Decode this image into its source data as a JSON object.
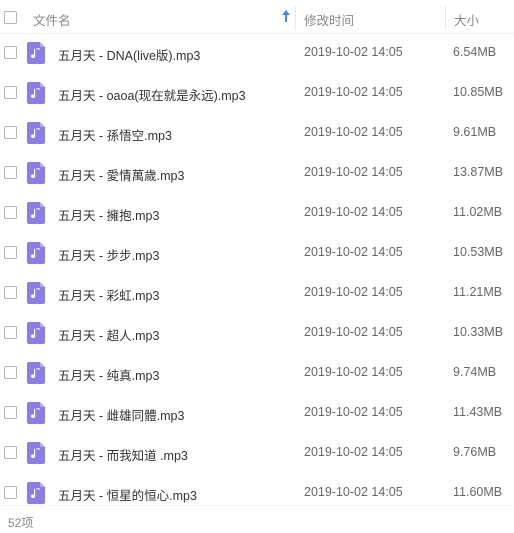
{
  "header": {
    "name_label": "文件名",
    "time_label": "修改时间",
    "size_label": "大小",
    "sort_direction": "ascending",
    "sort_color": "#3b8cff"
  },
  "icon_color": "#8a7ee6",
  "files": [
    {
      "name": "五月天 - DNA(live版).mp3",
      "time": "2019-10-02 14:05",
      "size": "6.54MB"
    },
    {
      "name": "五月天 - oaoa(现在就是永远).mp3",
      "time": "2019-10-02 14:05",
      "size": "10.85MB"
    },
    {
      "name": "五月天 - 孫悟空.mp3",
      "time": "2019-10-02 14:05",
      "size": "9.61MB"
    },
    {
      "name": "五月天 - 愛情萬歲.mp3",
      "time": "2019-10-02 14:05",
      "size": "13.87MB"
    },
    {
      "name": "五月天 - 擁抱.mp3",
      "time": "2019-10-02 14:05",
      "size": "11.02MB"
    },
    {
      "name": "五月天 - 步步.mp3",
      "time": "2019-10-02 14:05",
      "size": "10.53MB"
    },
    {
      "name": "五月天 - 彩虹.mp3",
      "time": "2019-10-02 14:05",
      "size": "11.21MB"
    },
    {
      "name": "五月天 - 超人.mp3",
      "time": "2019-10-02 14:05",
      "size": "10.33MB"
    },
    {
      "name": "五月天 - 纯真.mp3",
      "time": "2019-10-02 14:05",
      "size": "9.74MB"
    },
    {
      "name": "五月天 - 雌雄同體.mp3",
      "time": "2019-10-02 14:05",
      "size": "11.43MB"
    },
    {
      "name": "五月天 - 而我知道 .mp3",
      "time": "2019-10-02 14:05",
      "size": "9.76MB"
    },
    {
      "name": "五月天 - 恒星的恒心.mp3",
      "time": "2019-10-02 14:05",
      "size": "11.60MB"
    }
  ],
  "footer": {
    "count_label": "52项"
  }
}
